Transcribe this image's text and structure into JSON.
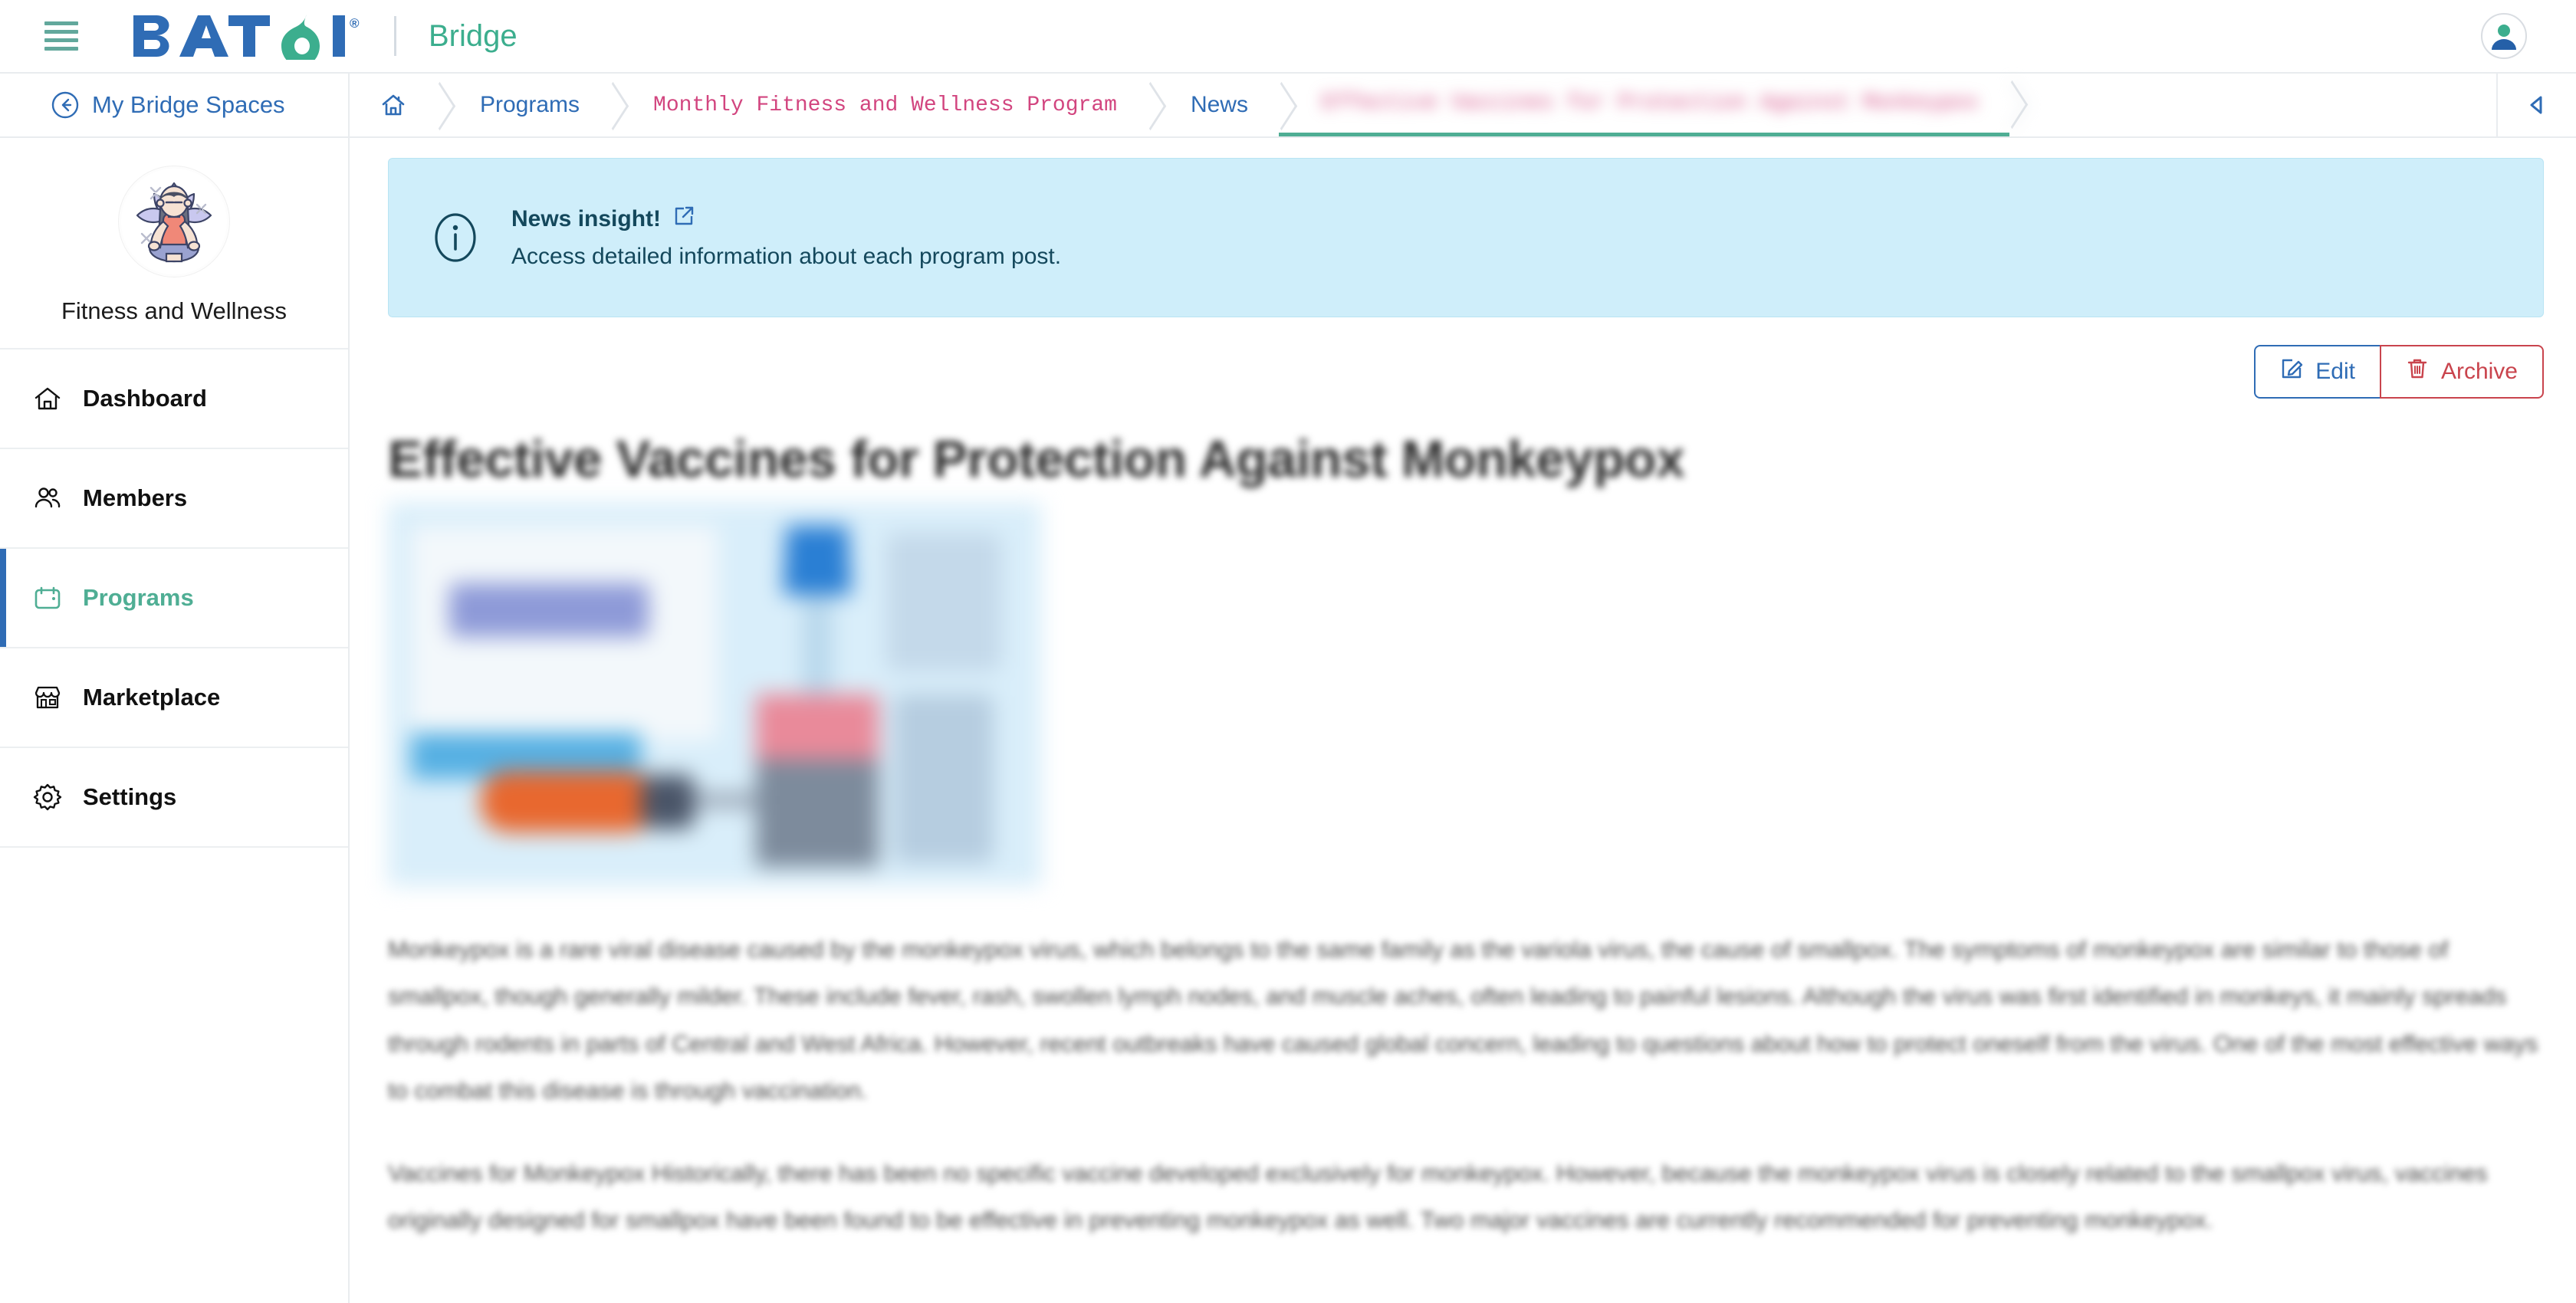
{
  "topbar": {
    "menu_icon": "hamburger-icon",
    "logo_text": "BATOI",
    "logo_registered": "®",
    "product_name": "Bridge",
    "avatar_icon": "user-avatar-icon"
  },
  "subnav": {
    "back_label": "My Bridge Spaces",
    "back_icon": "arrow-left-circle-icon",
    "collapse_icon": "caret-left-icon",
    "breadcrumbs": [
      {
        "label": "",
        "icon": "home-icon",
        "style": "icon",
        "active": false
      },
      {
        "label": "Programs",
        "icon": "",
        "style": "link",
        "active": false
      },
      {
        "label": "Monthly Fitness and Wellness Program",
        "icon": "",
        "style": "mono",
        "active": false
      },
      {
        "label": "News",
        "icon": "",
        "style": "link",
        "active": false
      },
      {
        "label": "Effective Vaccines for Protection Against Monkeypox",
        "icon": "",
        "style": "mono-blurred",
        "active": true
      }
    ]
  },
  "sidebar": {
    "space_name": "Fitness and Wellness",
    "space_avatar_icon": "yoga-meditation-avatar",
    "items": [
      {
        "label": "Dashboard",
        "icon": "home-icon",
        "active": false
      },
      {
        "label": "Members",
        "icon": "users-icon",
        "active": false
      },
      {
        "label": "Programs",
        "icon": "calendar-icon",
        "active": true
      },
      {
        "label": "Marketplace",
        "icon": "storefront-icon",
        "active": false
      },
      {
        "label": "Settings",
        "icon": "gear-icon",
        "active": false
      }
    ]
  },
  "main": {
    "alert": {
      "icon": "info-circle-icon",
      "title": "News insight!",
      "link_icon": "external-link-icon",
      "text": "Access detailed information about each program post."
    },
    "actions": {
      "edit_label": "Edit",
      "edit_icon": "pencil-square-icon",
      "archive_label": "Archive",
      "archive_icon": "trash-icon"
    },
    "article": {
      "title": "Effective Vaccines for Protection Against Monkeypox",
      "image_alt": "vaccine-vials-and-syringe-photo",
      "paragraphs": [
        "Monkeypox is a rare viral disease caused by the monkeypox virus, which belongs to the same family as the variola virus, the cause of smallpox. The symptoms of monkeypox are similar to those of smallpox, though generally milder. These include fever, rash, swollen lymph nodes, and muscle aches, often leading to painful lesions. Although the virus was first identified in monkeys, it mainly spreads through rodents in parts of Central and West Africa. However, recent outbreaks have caused global concern, leading to questions about how to protect oneself from the virus. One of the most effective ways to combat this disease is through vaccination.",
        "Vaccines for Monkeypox Historically, there has been no specific vaccine developed exclusively for monkeypox. However, because the monkeypox virus is closely related to the smallpox virus, vaccines originally designed for smallpox have been found to be effective in preventing monkeypox as well. Two major vaccines are currently recommended for preventing monkeypox."
      ]
    }
  },
  "colors": {
    "brand_blue": "#2f6cb5",
    "brand_green": "#3cae8e",
    "accent_teal": "#4fae94",
    "crumb_pink": "#d2457f",
    "alert_bg": "#cfeefa",
    "alert_fg": "#14485c",
    "danger_red": "#c9444d"
  }
}
